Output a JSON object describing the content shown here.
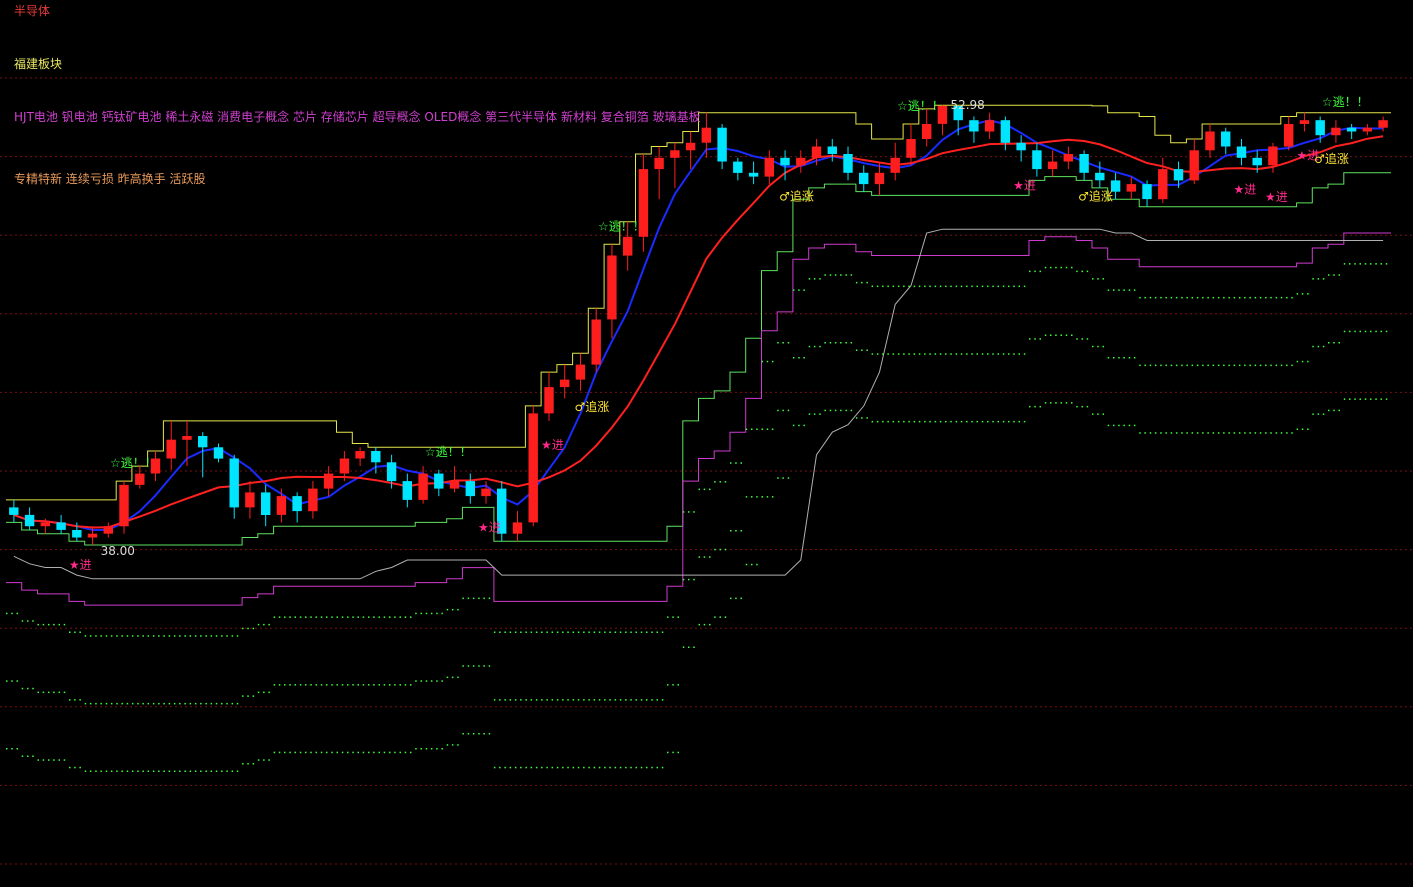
{
  "header": {
    "industry": "半导体",
    "region": "福建板块",
    "concepts": "HJT电池 钒电池 钙钛矿电池 稀土永磁 消费电子概念 芯片 存储芯片 超导概念 OLED概念 第三代半导体 新材料 复合铜箔 玻璃基板",
    "styles": "专精特新 连续亏损 昨高换手 活跃股"
  },
  "colors": {
    "background": "#000000",
    "up": "#ff1e1e",
    "down": "#00e5ff",
    "ma_fast": "#1a2bff",
    "ma_slow": "#ff2020",
    "band_upper": "#e6e64a",
    "band_lower": "#5ee35e",
    "band_gray": "#b0b0b0",
    "band_magenta": "#d03ad0",
    "dots": "#3cff3c",
    "grid": "#7a1010",
    "signal_escape": "#3cff3c",
    "signal_enter": "#ff2a8a",
    "signal_chase": "#ffe633"
  },
  "chart_data": {
    "type": "candlestick",
    "y_range": [
      33,
      55
    ],
    "grid": "horizontal dashed",
    "price_labels": {
      "high": "52.98",
      "low": "38.00"
    },
    "signals": {
      "escape": "☆逃！！",
      "enter": "★进",
      "chase": "♂追涨"
    },
    "candles": [
      [
        0,
        42.3,
        42.1,
        42.5,
        41.9
      ],
      [
        1,
        42.1,
        41.8,
        42.3,
        41.7
      ],
      [
        2,
        41.8,
        41.9,
        42.0,
        41.6
      ],
      [
        3,
        41.9,
        41.7,
        42.1,
        41.6
      ],
      [
        4,
        41.7,
        41.5,
        41.9,
        41.4
      ],
      [
        5,
        41.5,
        41.6,
        41.8,
        41.3
      ],
      [
        6,
        41.6,
        41.8,
        41.9,
        41.5
      ],
      [
        7,
        41.8,
        42.9,
        43.0,
        41.6
      ],
      [
        8,
        42.9,
        43.2,
        43.4,
        42.8
      ],
      [
        9,
        43.2,
        43.6,
        43.8,
        43.0
      ],
      [
        10,
        43.6,
        44.1,
        44.6,
        43.3
      ],
      [
        11,
        44.1,
        44.2,
        44.6,
        43.4
      ],
      [
        12,
        44.2,
        43.9,
        44.3,
        43.1
      ],
      [
        13,
        43.9,
        43.6,
        44.0,
        43.5
      ],
      [
        14,
        43.6,
        42.3,
        43.7,
        42.0
      ],
      [
        15,
        42.3,
        42.7,
        43.0,
        42.0
      ],
      [
        16,
        42.7,
        42.1,
        42.9,
        41.8
      ],
      [
        17,
        42.1,
        42.6,
        42.8,
        41.9
      ],
      [
        18,
        42.6,
        42.2,
        42.7,
        41.9
      ],
      [
        19,
        42.2,
        42.8,
        43.0,
        42.0
      ],
      [
        20,
        42.8,
        43.2,
        43.4,
        42.6
      ],
      [
        21,
        43.2,
        43.6,
        43.8,
        43.0
      ],
      [
        22,
        43.6,
        43.8,
        43.9,
        43.4
      ],
      [
        23,
        43.8,
        43.5,
        43.9,
        43.2
      ],
      [
        24,
        43.5,
        43.0,
        43.7,
        42.8
      ],
      [
        25,
        43.0,
        42.5,
        43.2,
        42.3
      ],
      [
        26,
        42.5,
        43.2,
        43.4,
        42.4
      ],
      [
        27,
        43.2,
        42.8,
        43.3,
        42.6
      ],
      [
        28,
        42.8,
        43.0,
        43.4,
        42.7
      ],
      [
        29,
        43.0,
        42.6,
        43.2,
        42.4
      ],
      [
        30,
        42.6,
        42.8,
        43.0,
        42.4
      ],
      [
        31,
        42.8,
        41.6,
        43.0,
        41.4
      ],
      [
        32,
        41.6,
        41.9,
        42.2,
        41.4
      ],
      [
        33,
        41.9,
        44.8,
        45.0,
        41.8
      ],
      [
        34,
        44.8,
        45.5,
        45.9,
        44.6
      ],
      [
        35,
        45.5,
        45.7,
        46.1,
        45.2
      ],
      [
        36,
        45.7,
        46.1,
        46.4,
        45.4
      ],
      [
        37,
        46.1,
        47.3,
        47.6,
        45.9
      ],
      [
        38,
        47.3,
        49.0,
        49.3,
        46.8
      ],
      [
        39,
        49.0,
        49.5,
        49.9,
        48.6
      ],
      [
        40,
        49.5,
        51.3,
        51.7,
        49.1
      ],
      [
        41,
        51.3,
        51.6,
        51.9,
        50.5
      ],
      [
        42,
        51.6,
        51.8,
        52.0,
        50.8
      ],
      [
        43,
        51.8,
        52.0,
        52.3,
        51.3
      ],
      [
        44,
        52.0,
        52.4,
        52.8,
        51.6
      ],
      [
        45,
        52.4,
        51.5,
        52.5,
        51.3
      ],
      [
        46,
        51.5,
        51.2,
        51.6,
        51.0
      ],
      [
        47,
        51.2,
        51.1,
        51.5,
        50.9
      ],
      [
        48,
        51.1,
        51.6,
        51.8,
        50.9
      ],
      [
        49,
        51.6,
        51.4,
        51.8,
        51.0
      ],
      [
        50,
        51.4,
        51.6,
        51.8,
        51.2
      ],
      [
        51,
        51.6,
        51.9,
        52.1,
        51.4
      ],
      [
        52,
        51.9,
        51.7,
        52.1,
        51.5
      ],
      [
        53,
        51.7,
        51.2,
        51.9,
        51.0
      ],
      [
        54,
        51.2,
        50.9,
        51.4,
        50.7
      ],
      [
        55,
        50.9,
        51.2,
        51.5,
        50.6
      ],
      [
        56,
        51.2,
        51.6,
        52.0,
        51.0
      ],
      [
        57,
        51.6,
        52.1,
        52.5,
        51.4
      ],
      [
        58,
        52.1,
        52.5,
        52.9,
        51.9
      ],
      [
        59,
        52.5,
        52.98,
        53.0,
        52.2
      ],
      [
        60,
        52.98,
        52.6,
        52.98,
        52.2
      ],
      [
        61,
        52.6,
        52.3,
        52.7,
        52.0
      ],
      [
        62,
        52.3,
        52.6,
        52.8,
        52.1
      ],
      [
        63,
        52.6,
        52.0,
        52.7,
        51.8
      ],
      [
        64,
        52.0,
        51.8,
        52.2,
        51.5
      ],
      [
        65,
        51.8,
        51.3,
        52.0,
        51.1
      ],
      [
        66,
        51.3,
        51.5,
        51.8,
        51.1
      ],
      [
        67,
        51.5,
        51.7,
        51.9,
        51.3
      ],
      [
        68,
        51.7,
        51.2,
        51.8,
        51.0
      ],
      [
        69,
        51.2,
        51.0,
        51.5,
        50.8
      ],
      [
        70,
        51.0,
        50.7,
        51.2,
        50.5
      ],
      [
        71,
        50.7,
        50.9,
        51.1,
        50.5
      ],
      [
        72,
        50.9,
        50.5,
        51.0,
        50.3
      ],
      [
        73,
        50.5,
        51.3,
        51.6,
        50.4
      ],
      [
        74,
        51.3,
        51.0,
        51.5,
        50.8
      ],
      [
        75,
        51.0,
        51.8,
        52.1,
        50.9
      ],
      [
        76,
        51.8,
        52.3,
        52.5,
        51.6
      ],
      [
        77,
        52.3,
        51.9,
        52.4,
        51.7
      ],
      [
        78,
        51.9,
        51.6,
        52.1,
        51.4
      ],
      [
        79,
        51.6,
        51.4,
        51.8,
        51.2
      ],
      [
        80,
        51.4,
        51.9,
        52.0,
        51.2
      ],
      [
        81,
        51.9,
        52.5,
        52.7,
        51.8
      ],
      [
        82,
        52.5,
        52.6,
        52.8,
        52.3
      ],
      [
        83,
        52.6,
        52.2,
        52.7,
        52.0
      ],
      [
        84,
        52.2,
        52.4,
        52.6,
        52.0
      ],
      [
        85,
        52.4,
        52.3,
        52.5,
        52.1
      ],
      [
        86,
        52.3,
        52.4,
        52.5,
        52.2
      ],
      [
        87,
        52.4,
        52.6,
        52.7,
        52.3
      ]
    ]
  }
}
